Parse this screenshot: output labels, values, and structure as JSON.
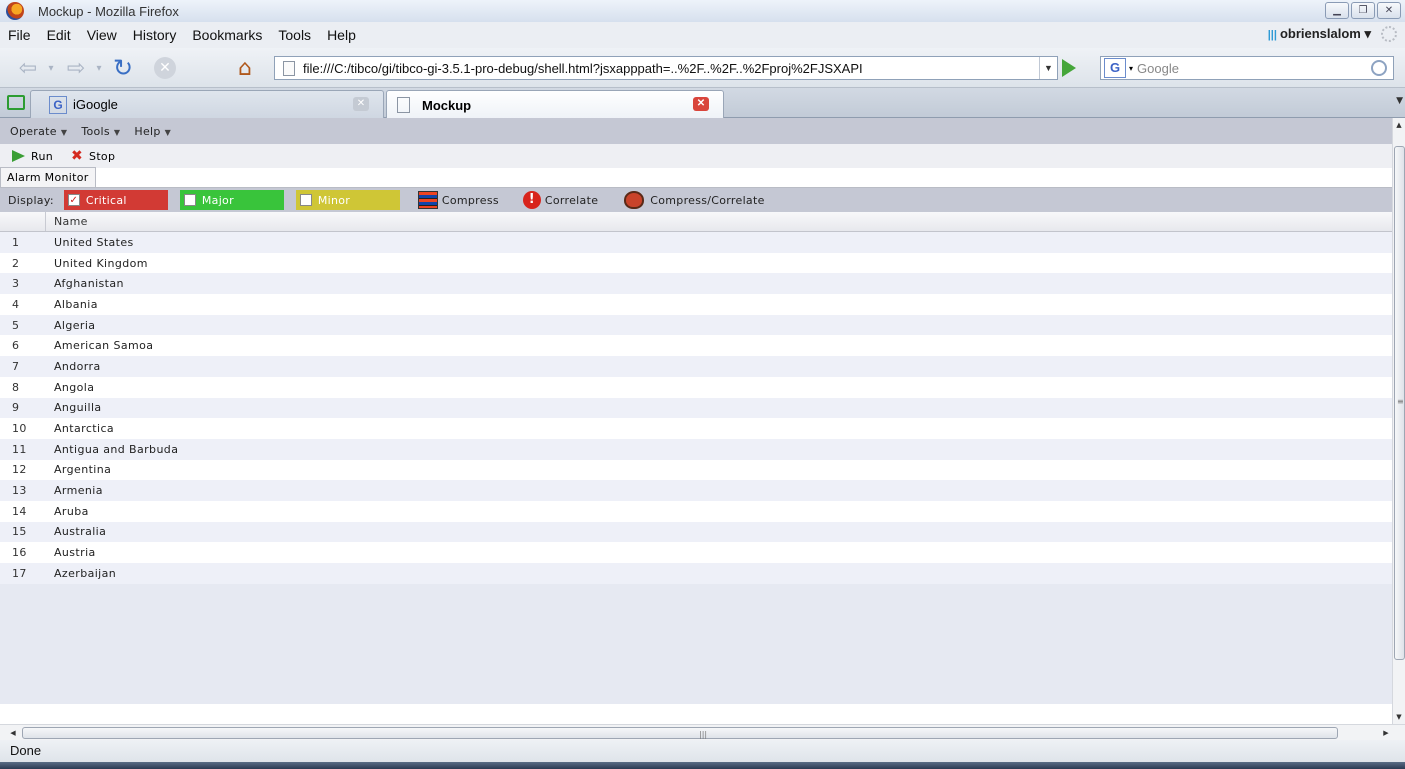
{
  "window": {
    "title": "Mockup - Mozilla Firefox"
  },
  "menubar": {
    "items": [
      "File",
      "Edit",
      "View",
      "History",
      "Bookmarks",
      "Tools",
      "Help"
    ],
    "profile": "obrienslalom"
  },
  "navbar": {
    "url": "file:///C:/tibco/gi/tibco-gi-3.5.1-pro-debug/shell.html?jsxapppath=..%2F..%2F..%2Fproj%2FJSXAPI",
    "search_engine": "G",
    "search_placeholder": "Google"
  },
  "tabs": [
    {
      "label": "iGoogle",
      "active": false,
      "icon": "google-icon"
    },
    {
      "label": "Mockup",
      "active": true,
      "icon": "page-icon"
    }
  ],
  "app": {
    "menu": [
      "Operate",
      "Tools",
      "Help"
    ],
    "toolbar": {
      "run_label": "Run",
      "stop_label": "Stop"
    },
    "panel_tab": "Alarm Monitor",
    "display": {
      "label": "Display:",
      "filters": [
        {
          "label": "Critical",
          "checked": true,
          "color": "#d23a34"
        },
        {
          "label": "Major",
          "checked": false,
          "color": "#39c43b"
        },
        {
          "label": "Minor",
          "checked": false,
          "color": "#cfc636"
        }
      ],
      "actions": [
        "Compress",
        "Correlate",
        "Compress/Correlate"
      ]
    },
    "grid": {
      "header": "Name",
      "rows": [
        {
          "num": "1",
          "name": "United States"
        },
        {
          "num": "2",
          "name": "United Kingdom"
        },
        {
          "num": "3",
          "name": "Afghanistan"
        },
        {
          "num": "4",
          "name": "Albania"
        },
        {
          "num": "5",
          "name": "Algeria"
        },
        {
          "num": "6",
          "name": "American Samoa"
        },
        {
          "num": "7",
          "name": "Andorra"
        },
        {
          "num": "8",
          "name": "Angola"
        },
        {
          "num": "9",
          "name": "Anguilla"
        },
        {
          "num": "10",
          "name": "Antarctica"
        },
        {
          "num": "11",
          "name": "Antigua and Barbuda"
        },
        {
          "num": "12",
          "name": "Argentina"
        },
        {
          "num": "13",
          "name": "Armenia"
        },
        {
          "num": "14",
          "name": "Aruba"
        },
        {
          "num": "15",
          "name": "Australia"
        },
        {
          "num": "16",
          "name": "Austria"
        },
        {
          "num": "17",
          "name": "Azerbaijan"
        }
      ]
    }
  },
  "status": {
    "text": "Done"
  }
}
